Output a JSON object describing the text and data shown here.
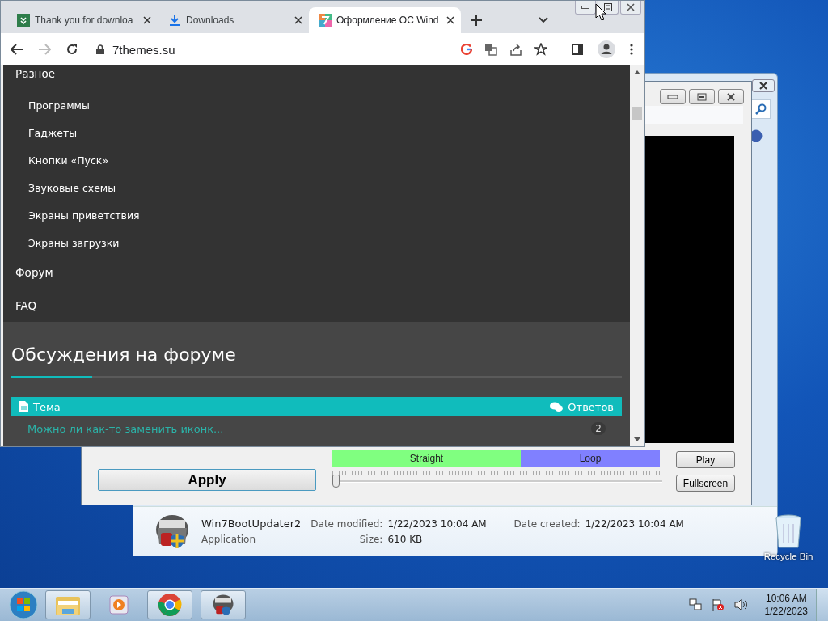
{
  "browser": {
    "tabs": [
      {
        "title": "Thank you for downloa",
        "kind": "page",
        "selected": false
      },
      {
        "title": "Downloads",
        "kind": "download",
        "selected": false
      },
      {
        "title": "Оформление ОС Wind",
        "kind": "page",
        "selected": true
      }
    ],
    "url": "7themes.su",
    "menu": [
      {
        "label": "Разное",
        "children": [
          {
            "label": "Программы"
          },
          {
            "label": "Гаджеты"
          },
          {
            "label": "Кнопки «Пуск»"
          },
          {
            "label": "Звуковые схемы"
          },
          {
            "label": "Экраны приветствия"
          },
          {
            "label": "Экраны загрузки"
          }
        ]
      },
      {
        "label": "Форум"
      },
      {
        "label": "FAQ"
      }
    ],
    "forum": {
      "title": "Обсуждения на форуме",
      "columns": [
        "Тема",
        "Ответов"
      ],
      "rows": [
        {
          "topic": "Можно ли как-то заменить иконк...",
          "replies": "2"
        }
      ]
    }
  },
  "updater": {
    "modes": [
      {
        "label": "Straight",
        "color": "#80ff80"
      },
      {
        "label": "Loop",
        "color": "#8080ff"
      }
    ],
    "slider": {
      "level": 0
    },
    "apply": "Apply",
    "play": "Play",
    "fullscreen": "Fullscreen"
  },
  "details": {
    "name": "Win7BootUpdater2",
    "type": "Application",
    "fields": [
      {
        "label": "Date modified:",
        "value": "1/22/2023 10:04 AM"
      },
      {
        "label": "Date created:",
        "value": "1/22/2023 10:04 AM"
      },
      {
        "label": "Size:",
        "value": "610 KB"
      }
    ]
  },
  "desktop": {
    "icons": [
      {
        "label": "Recycle Bin"
      }
    ]
  },
  "taskbar": {
    "time": "10:06 AM",
    "date": "1/22/2023"
  }
}
